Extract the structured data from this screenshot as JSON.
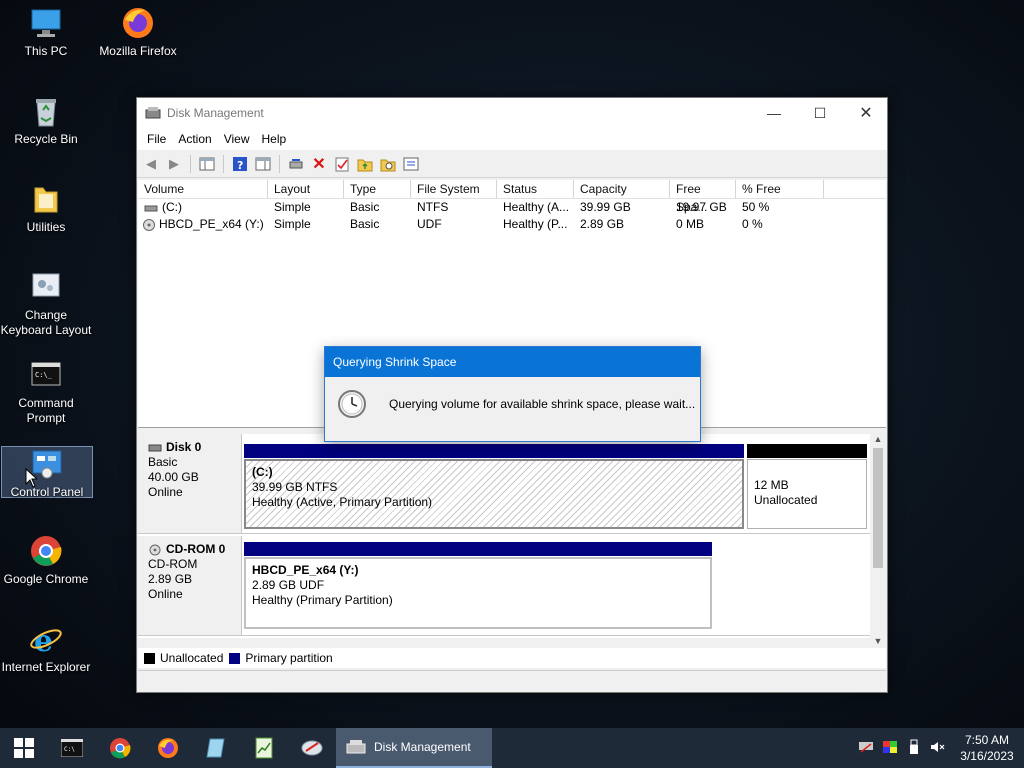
{
  "desktop": {
    "icons": [
      {
        "label": "This PC"
      },
      {
        "label": "Mozilla Firefox"
      },
      {
        "label": "Recycle Bin"
      },
      {
        "label": "Utilities"
      },
      {
        "label": "Change Keyboard Layout"
      },
      {
        "label": "Command Prompt"
      },
      {
        "label": "Control Panel"
      },
      {
        "label": "Google Chrome"
      },
      {
        "label": "Internet Explorer"
      }
    ]
  },
  "window": {
    "title": "Disk Management",
    "menu": [
      "File",
      "Action",
      "View",
      "Help"
    ],
    "columns": [
      "Volume",
      "Layout",
      "Type",
      "File System",
      "Status",
      "Capacity",
      "Free Spa...",
      "% Free"
    ],
    "volumes": [
      {
        "volume": "(C:)",
        "layout": "Simple",
        "type": "Basic",
        "fs": "NTFS",
        "status": "Healthy (A...",
        "capacity": "39.99 GB",
        "free": "19.97 GB",
        "pct": "50 %"
      },
      {
        "volume": "HBCD_PE_x64 (Y:)",
        "layout": "Simple",
        "type": "Basic",
        "fs": "UDF",
        "status": "Healthy (P...",
        "capacity": "2.89 GB",
        "free": "0 MB",
        "pct": "0 %"
      }
    ],
    "disks": [
      {
        "name": "Disk 0",
        "kind": "Basic",
        "size": "40.00 GB",
        "state": "Online",
        "partitions": [
          {
            "title": "(C:)",
            "line2": "39.99 GB NTFS",
            "line3": "Healthy (Active, Primary Partition)"
          },
          {
            "title": "",
            "line2": "12 MB",
            "line3": "Unallocated"
          }
        ]
      },
      {
        "name": "CD-ROM 0",
        "kind": "CD-ROM",
        "size": "2.89 GB",
        "state": "Online",
        "partitions": [
          {
            "title": "HBCD_PE_x64  (Y:)",
            "line2": "2.89 GB UDF",
            "line3": "Healthy (Primary Partition)"
          }
        ]
      }
    ],
    "legend": {
      "unallocated": "Unallocated",
      "primary": "Primary partition"
    },
    "colors": {
      "primary": "#000080",
      "unallocated": "#000000",
      "accent": "#0a74d6"
    }
  },
  "dialog": {
    "title": "Querying Shrink Space",
    "message": "Querying volume for available shrink space, please wait..."
  },
  "taskbar": {
    "active_app": "Disk Management",
    "time": "7:50 AM",
    "date": "3/16/2023"
  }
}
